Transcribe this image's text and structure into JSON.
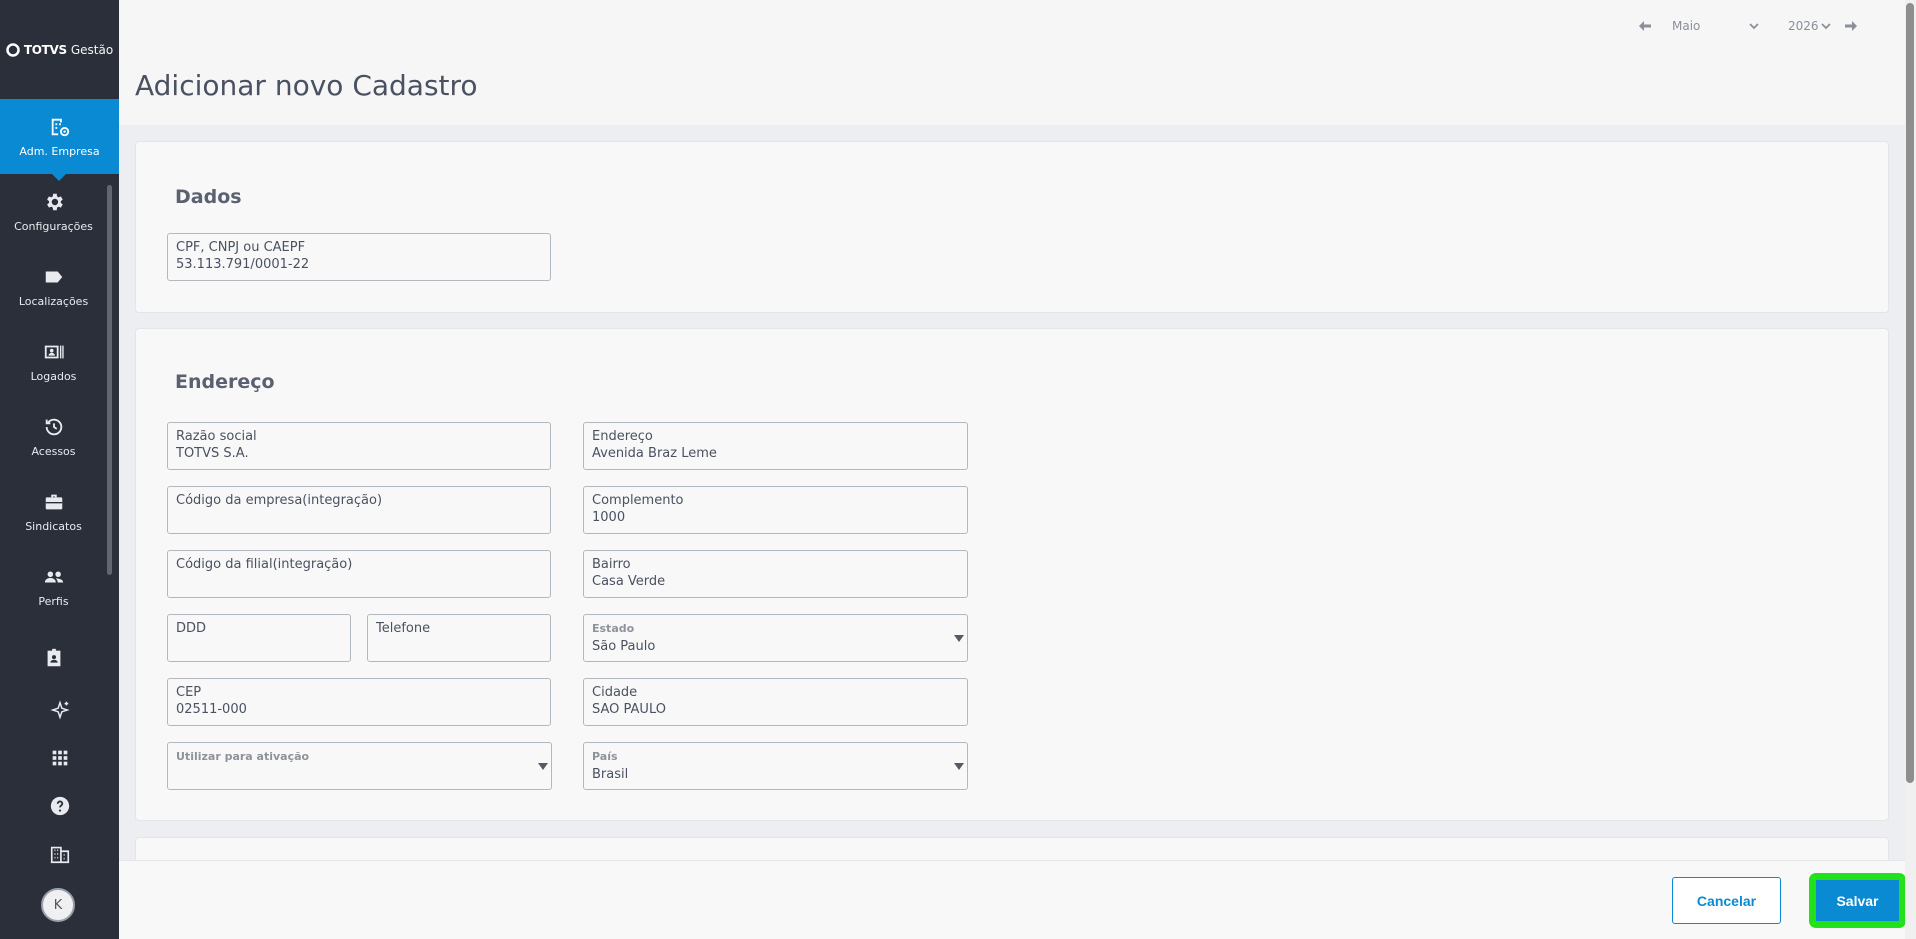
{
  "brand": {
    "logo_mark": "TOTVS",
    "logo_sub": "Gestão"
  },
  "sidebar": {
    "items": [
      {
        "label": "Adm. Empresa",
        "icon": "company-admin-icon",
        "active": true
      },
      {
        "label": "Configurações",
        "icon": "gear-icon"
      },
      {
        "label": "Localizações",
        "icon": "tag-icon"
      },
      {
        "label": "Logados",
        "icon": "id-card-icon"
      },
      {
        "label": "Acessos",
        "icon": "history-icon"
      },
      {
        "label": "Sindicatos",
        "icon": "briefcase-icon"
      },
      {
        "label": "Perfis",
        "icon": "people-icon"
      },
      {
        "label": "",
        "icon": "badge-icon"
      }
    ],
    "bottom": [
      "sparkle-icon",
      "apps-grid-icon",
      "help-icon",
      "building-icon"
    ],
    "avatar_initial": "K"
  },
  "date_nav": {
    "month": "Maio",
    "year": "2026"
  },
  "page": {
    "title": "Adicionar novo Cadastro"
  },
  "dados": {
    "title": "Dados",
    "document": {
      "label": "CPF, CNPJ ou CAEPF",
      "value": "53.113.791/0001-22"
    }
  },
  "endereco": {
    "title": "Endereço",
    "razao_social": {
      "label": "Razão social",
      "value": "TOTVS S.A."
    },
    "codigo_empresa": {
      "label": "Código da empresa(integração)",
      "value": ""
    },
    "codigo_filial": {
      "label": "Código da filial(integração)",
      "value": ""
    },
    "ddd": {
      "label": "DDD",
      "value": ""
    },
    "telefone": {
      "label": "Telefone",
      "value": ""
    },
    "cep": {
      "label": "CEP",
      "value": "02511-000"
    },
    "ativacao": {
      "label": "Utilizar para ativação",
      "value": ""
    },
    "endereco": {
      "label": "Endereço",
      "value": "Avenida Braz Leme"
    },
    "complemento": {
      "label": "Complemento",
      "value": "1000"
    },
    "bairro": {
      "label": "Bairro",
      "value": "Casa Verde"
    },
    "estado": {
      "label": "Estado",
      "value": "São Paulo"
    },
    "cidade": {
      "label": "Cidade",
      "value": "SAO PAULO"
    },
    "pais": {
      "label": "País",
      "value": "Brasil"
    }
  },
  "footer": {
    "cancel_label": "Cancelar",
    "save_label": "Salvar"
  },
  "colors": {
    "accent": "#0a8ad3",
    "sidebar_bg": "#2b2f3a",
    "highlight": "#22e11a"
  }
}
